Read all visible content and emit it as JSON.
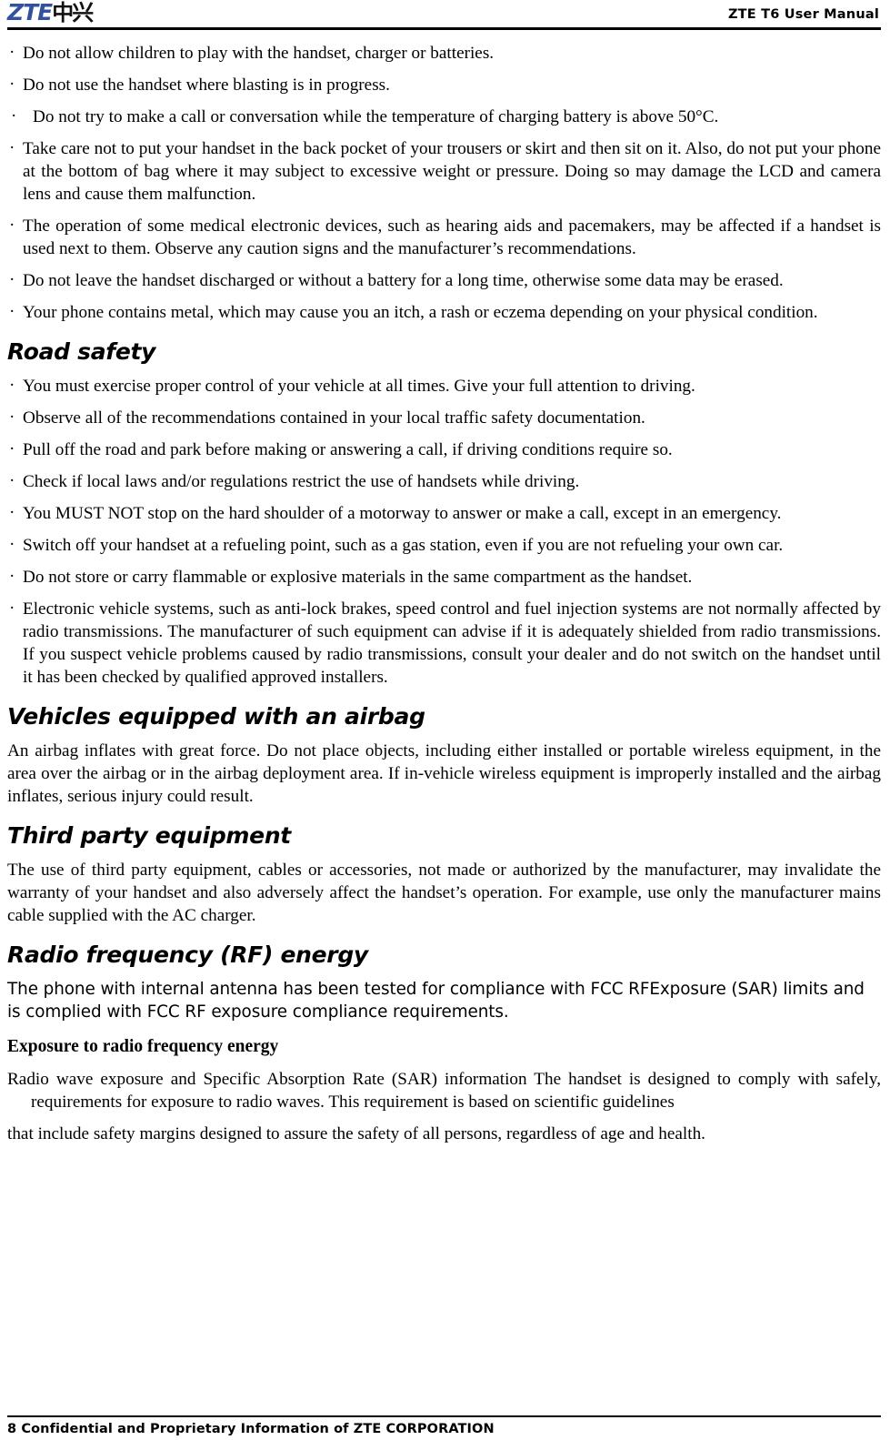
{
  "header": {
    "logo_latin": "ZTE",
    "logo_cjk": "中兴",
    "logo_color": "#33529c",
    "title": "ZTE T6 User Manual"
  },
  "body": {
    "safety_bullets": [
      "Do not allow children to play with the handset, charger or batteries.",
      "Do not use the handset where blasting is in progress.",
      "Do not try to make a call or conversation while the temperature of charging battery is above 50°C.",
      "Take care not to put your handset in the back pocket of your trousers or skirt and then sit on it. Also, do not put your phone at the bottom of bag where it may subject to excessive weight or pressure. Doing so may damage the LCD and camera lens and cause them malfunction.",
      "The operation of some medical electronic devices, such as hearing aids and pacemakers, may be affected if a handset is used next to them. Observe any caution signs and the manufacturer’s recommendations.",
      "Do not leave the handset discharged or without a battery for a long time, otherwise some data may be erased.",
      "Your phone contains metal, which may cause you an itch, a rash or eczema depending on your physical condition."
    ],
    "road_safety": {
      "heading": "Road safety",
      "bullets": [
        "You must exercise proper control of your vehicle at all times. Give your full attention to driving.",
        "Observe all of the recommendations contained in your local traffic safety documentation.",
        "Pull off the road and park before making or answering a call, if driving conditions require so.",
        "Check if local laws and/or regulations restrict the use of handsets while driving.",
        "You MUST NOT stop on the hard shoulder of a motorway to answer or make a call, except in an emergency.",
        "Switch off your handset at a refueling point, such as a gas station, even if you are not refueling your own car.",
        "Do not store or carry flammable or explosive materials in the same compartment as the handset.",
        "Electronic vehicle systems, such as anti-lock brakes, speed control and fuel injection systems are not normally affected by radio transmissions. The manufacturer of such equipment can advise if it is adequately shielded from radio transmissions. If you suspect vehicle problems caused by radio transmissions, consult your dealer and do not switch on the handset until it has been checked by qualified approved installers."
      ]
    },
    "airbag": {
      "heading": "Vehicles equipped with an airbag",
      "paragraph": "An airbag inflates with great force. Do not place objects, including either installed or portable wireless equipment, in the area over the airbag or in the airbag deployment area. If in-vehicle wireless equipment is improperly installed and the airbag inflates, serious injury could result."
    },
    "third_party": {
      "heading": "Third party equipment",
      "paragraph": "The use of third party equipment, cables or accessories, not made or authorized by the manufacturer, may invalidate the warranty of your handset and also adversely affect the handset’s operation. For example, use only the manufacturer mains cable supplied with the AC charger."
    },
    "rf_energy": {
      "heading": "Radio frequency (RF) energy",
      "paragraph": "The phone with internal antenna has been tested for compliance with FCC RFExposure (SAR) limits and is complied with FCC RF exposure compliance requirements.",
      "subheading": "Exposure to radio frequency energy",
      "paragraph2": "Radio wave exposure and Specific Absorption Rate (SAR) information The handset is designed to comply with safely, requirements for exposure to radio waves. This requirement is based on scientific guidelines",
      "paragraph3": "that include safety margins designed to assure the safety of all persons, regardless of age and health."
    }
  },
  "footer": {
    "text": "8 Confidential and Proprietary Information of ZTE CORPORATION"
  }
}
